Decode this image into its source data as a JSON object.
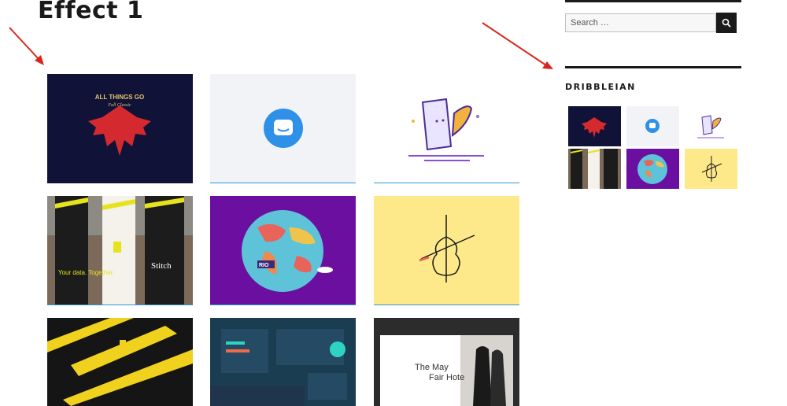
{
  "page": {
    "title": "Effect 1"
  },
  "sidebar": {
    "search": {
      "placeholder": "Search …"
    },
    "widget": {
      "title": "DRIBBLEIAN"
    }
  },
  "colors": {
    "arrow": "#d9261c",
    "accent_underline": "#2f9ad3",
    "navy": "#101238",
    "purple": "#6a0fa0",
    "yellow": "#fde98a"
  },
  "gallery": {
    "artwork_text": {
      "emblem_line1": "ALL THINGS GO",
      "emblem_line2": "Fall Classic",
      "banner_left": "Your data. Together.",
      "banner_right": "Stitch",
      "map_label": "RIO",
      "hotel_title_1": "The May",
      "hotel_title_2": "Fair Hote"
    }
  }
}
